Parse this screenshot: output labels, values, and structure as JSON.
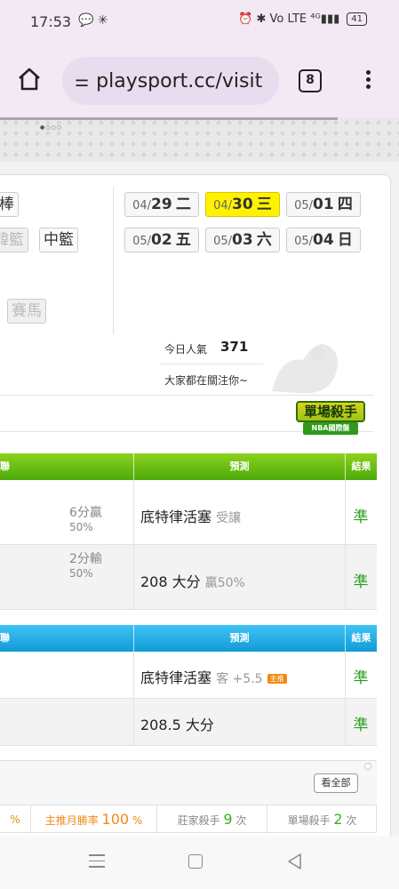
{
  "status": {
    "time": "17:53",
    "left_icons": "💬 ✳",
    "right_icons": "⏰ ✱ Vo LTE ⁴ᴳ▮▮▮",
    "battery": "41"
  },
  "browser": {
    "url": "playsport.cc/visit",
    "tab_count": "8"
  },
  "categories": [
    {
      "label": "棒",
      "muted": false
    },
    {
      "label": "韓籃",
      "muted": true
    },
    {
      "label": "中籃",
      "muted": false
    },
    {
      "label": "賽馬",
      "muted": true
    }
  ],
  "dates": [
    {
      "prefix": "04/",
      "day": "29",
      "weekday": "二"
    },
    {
      "prefix": "04/",
      "day": "30",
      "weekday": "三"
    },
    {
      "prefix": "05/",
      "day": "01",
      "weekday": "四"
    },
    {
      "prefix": "05/",
      "day": "02",
      "weekday": "五"
    },
    {
      "prefix": "05/",
      "day": "03",
      "weekday": "六"
    },
    {
      "prefix": "05/",
      "day": "04",
      "weekday": "日"
    }
  ],
  "popularity": {
    "label": "今日人氣",
    "value": "371",
    "note": "大家都在關注你~"
  },
  "badge": {
    "title": "單場殺手",
    "subtitle": "NBA國際盤"
  },
  "table1": {
    "header_left": "聯",
    "header_pred": "預測",
    "header_result": "結果",
    "rows": [
      {
        "left_main": "6分贏",
        "left_pct": "50%",
        "pred": "底特律活塞",
        "pred_sub": "受讓",
        "result": "準"
      },
      {
        "left_main": "2分輸",
        "left_pct": "50%",
        "pred": "208 大分",
        "pred_sub": "贏50%",
        "result": "準"
      }
    ]
  },
  "table2": {
    "header_left": "聯",
    "header_pred": "預測",
    "header_result": "結果",
    "rows": [
      {
        "pred": "底特律活塞",
        "pred_sub": "客 +5.5",
        "tag": "主推",
        "result": "準"
      },
      {
        "pred": "208.5 大分",
        "pred_sub": "",
        "result": "準"
      }
    ]
  },
  "summary": {
    "view_all": "看全部",
    "stat0": "%",
    "stat1": {
      "label": "主推月勝率",
      "value": "100",
      "unit": "%"
    },
    "stat2": {
      "label": "莊家殺手",
      "value": "9",
      "unit": "次"
    },
    "stat3": {
      "label": "單場殺手",
      "value": "2",
      "unit": "次"
    }
  },
  "colors": {
    "active_date": "#fff200",
    "green_header": "#4daa0c",
    "blue_header": "#119bd8",
    "accurate": "#2a9d1f"
  }
}
